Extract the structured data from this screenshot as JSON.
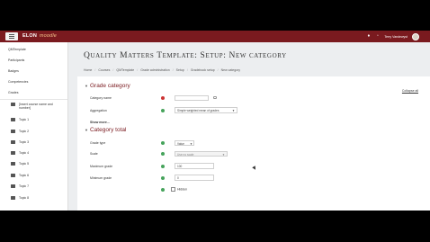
{
  "navbar": {
    "brand": "ELON",
    "brand_sub": "moodle",
    "icons": [
      "bell-icon",
      "chat-icon"
    ],
    "user_name": "Terry Vandewyst"
  },
  "sidebar": {
    "items": [
      {
        "label": "QMTemplate"
      },
      {
        "label": "Participants"
      },
      {
        "label": "Badges"
      },
      {
        "label": "Competencies"
      },
      {
        "label": "Grades"
      }
    ],
    "topics": [
      {
        "label": "[Insert course name and number]"
      },
      {
        "label": "Topic 1"
      },
      {
        "label": "Topic 2"
      },
      {
        "label": "Topic 3"
      },
      {
        "label": "Topic 4"
      },
      {
        "label": "Topic 5"
      },
      {
        "label": "Topic 6"
      },
      {
        "label": "Topic 7"
      },
      {
        "label": "Topic 8"
      }
    ]
  },
  "page": {
    "title": "Quality Matters Template: Setup: New category",
    "breadcrumb": [
      "Home",
      "Courses",
      "QMTemplate",
      "Grade administration",
      "Setup",
      "Gradebook setup",
      "New category"
    ],
    "collapse_all": "Collapse all"
  },
  "form": {
    "section_grade_category": "Grade category",
    "category_name_label": "Category name",
    "category_name_value": "",
    "aggregation_label": "Aggregation",
    "aggregation_value": "Simple weighted mean of grades",
    "show_more": "Show more...",
    "section_category_total": "Category total",
    "grade_type_label": "Grade type",
    "grade_type_value": "Value",
    "scale_label": "Scale",
    "scale_value": "Use no scale",
    "max_grade_label": "Maximum grade",
    "max_grade_value": "100",
    "min_grade_label": "Minimum grade",
    "min_grade_value": "0",
    "hidden_label": "Hidden"
  }
}
